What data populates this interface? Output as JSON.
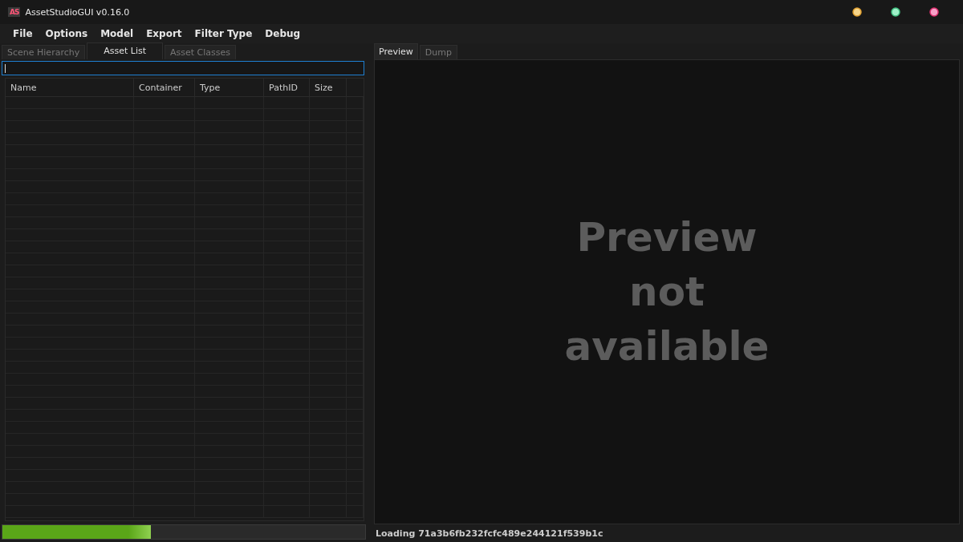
{
  "window": {
    "title": "AssetStudioGUI v0.16.0",
    "logo": "AS"
  },
  "menu": [
    "File",
    "Options",
    "Model",
    "Export",
    "Filter Type",
    "Debug"
  ],
  "left_tabs": [
    {
      "label": "Scene Hierarchy",
      "selected": false
    },
    {
      "label": "Asset List",
      "selected": true
    },
    {
      "label": "Asset Classes",
      "selected": false
    }
  ],
  "table": {
    "columns": [
      "Name",
      "Container",
      "Type",
      "PathID",
      "Size"
    ]
  },
  "progress": {
    "level": 0.41
  },
  "right_tabs": [
    {
      "label": "Preview",
      "selected": true
    },
    {
      "label": "Dump",
      "selected": false
    }
  ],
  "preview": {
    "message": "Preview not available"
  },
  "status_bar": "Loading 71a3b6fb232fcfc489e244121f539b1c"
}
